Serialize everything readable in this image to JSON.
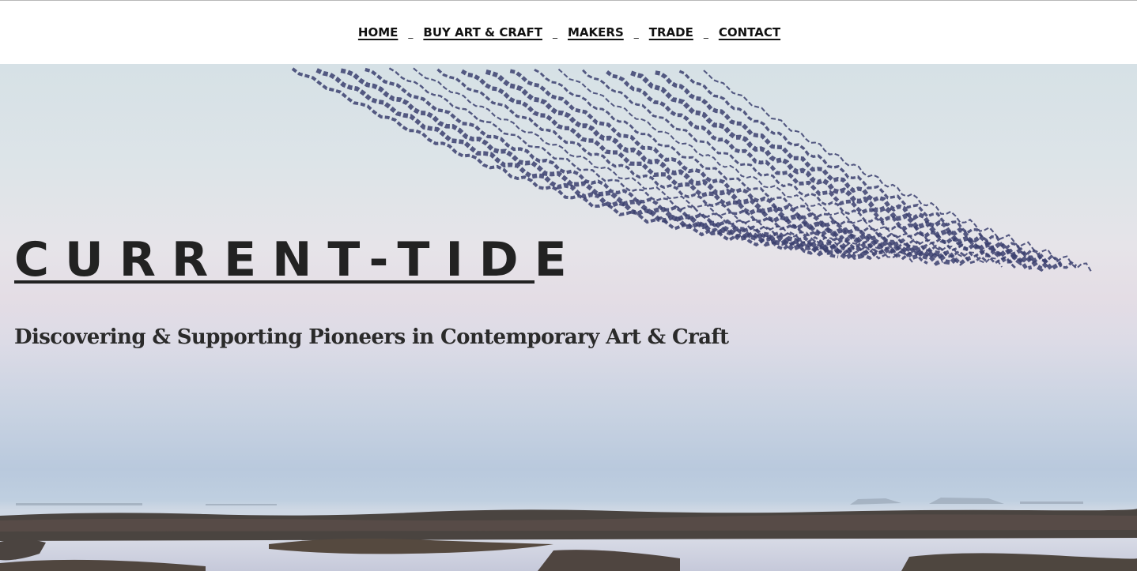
{
  "nav": {
    "items": [
      {
        "label": "HOME"
      },
      {
        "label": "BUY ART & CRAFT"
      },
      {
        "label": "MAKERS"
      },
      {
        "label": "TRADE"
      },
      {
        "label": "CONTACT"
      }
    ],
    "separator": "_"
  },
  "hero": {
    "brand": "CURRENT-TIDE",
    "tagline": "Discovering & Supporting Pioneers in Contemporary Art & Craft",
    "image": "sculpture-over-marsh"
  },
  "colors": {
    "text": "#222222",
    "sky_top": "#d6e1e6",
    "sky_mid": "#e6e4e9",
    "sky_low": "#b9c9dd",
    "sculpture": "#3b3f6e"
  }
}
